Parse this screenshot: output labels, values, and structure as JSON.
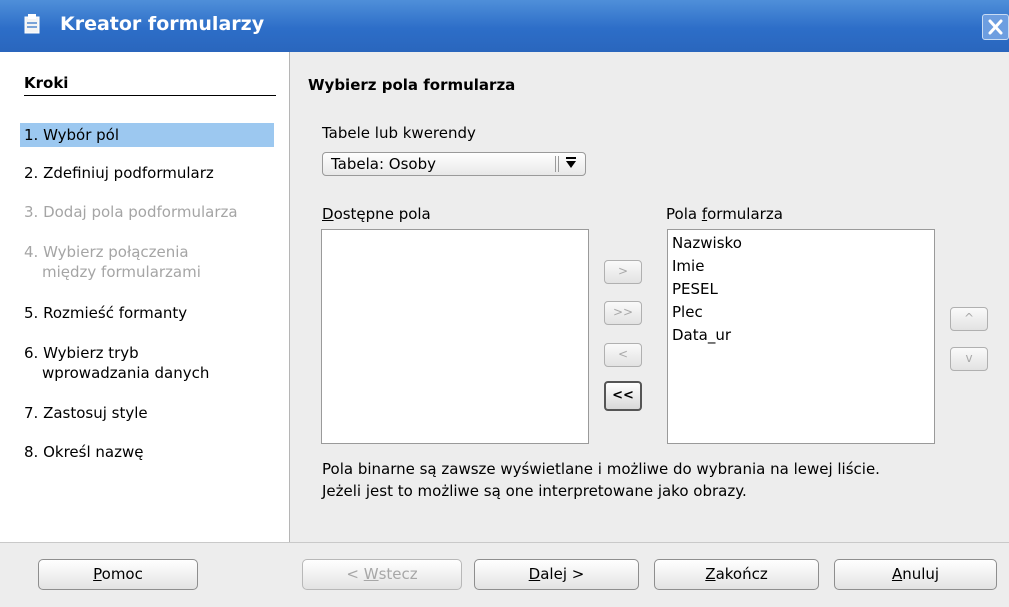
{
  "window": {
    "title": "Kreator formularzy"
  },
  "sidebar": {
    "heading": "Kroki",
    "steps": [
      {
        "label": "1. Wybór pól",
        "state": "active"
      },
      {
        "label": "2. Zdefiniuj podformularz",
        "state": "enabled"
      },
      {
        "label": "3. Dodaj pola podformularza",
        "state": "disabled"
      },
      {
        "label_line1": "4. Wybierz połączenia",
        "label_line2": "między formularzami",
        "state": "disabled"
      },
      {
        "label": "5. Rozmieść formanty",
        "state": "enabled"
      },
      {
        "label_line1": "6. Wybierz tryb",
        "label_line2": "wprowadzania danych",
        "state": "enabled"
      },
      {
        "label": "7. Zastosuj style",
        "state": "enabled"
      },
      {
        "label": "8. Określ nazwę",
        "state": "enabled"
      }
    ]
  },
  "main": {
    "title": "Wybierz pola formularza",
    "tables_label": "Tabele lub kwerendy",
    "table_select_value": "Tabela: Osoby",
    "available_label_mnemonic": "D",
    "available_label_rest": "ostępne pola",
    "available_fields": [],
    "form_fields_label_pre": "Pola ",
    "form_fields_label_mnemonic": "f",
    "form_fields_label_post": "ormularza",
    "form_fields": [
      "Nazwisko",
      "Imie",
      "PESEL",
      "Plec",
      "Data_ur"
    ],
    "move_buttons": {
      "add": ">",
      "add_all": ">>",
      "remove": "<",
      "remove_all": "<<"
    },
    "order_buttons": {
      "up": "^",
      "down": "v"
    },
    "note_line1": "Pola binarne są zawsze wyświetlane i możliwe do wybrania na lewej liście.",
    "note_line2": "Jeżeli jest to możliwe są one interpretowane jako obrazy."
  },
  "footer": {
    "help": {
      "mnemonic": "P",
      "rest": "omoc"
    },
    "back": {
      "pre": "< ",
      "mnemonic": "W",
      "rest": "stecz",
      "state": "disabled"
    },
    "next": {
      "mnemonic": "D",
      "rest": "alej >"
    },
    "finish": {
      "mnemonic": "Z",
      "rest": "akończ"
    },
    "cancel": {
      "mnemonic": "A",
      "rest": "nuluj"
    }
  }
}
